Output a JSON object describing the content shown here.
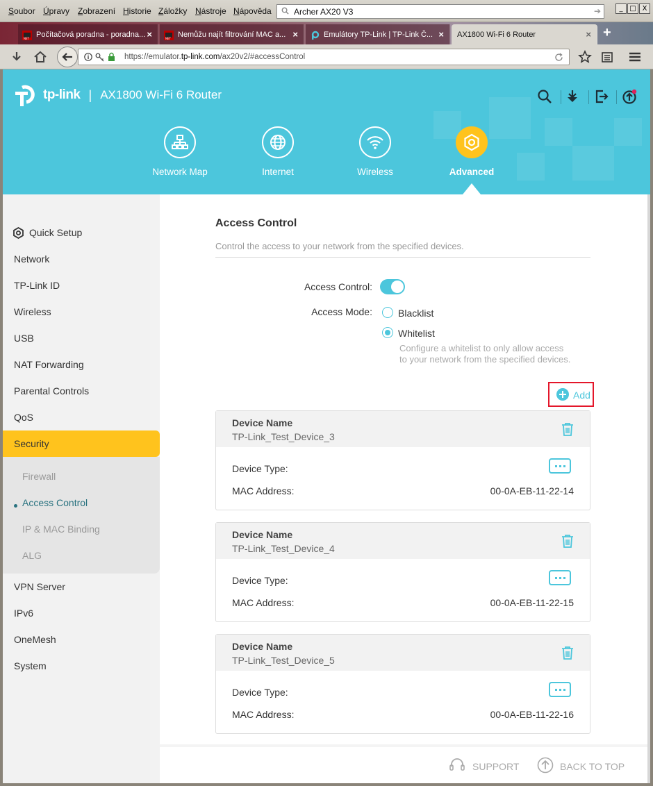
{
  "browser": {
    "menu": [
      "Soubor",
      "Úpravy",
      "Zobrazení",
      "Historie",
      "Záložky",
      "Nástroje",
      "Nápověda"
    ],
    "search_value": "Archer AX20 V3",
    "window_buttons": [
      "_",
      "□",
      "X"
    ],
    "tabs": [
      {
        "label": "Počítačová poradna - poradna...",
        "icon": "favicon-pc-poradna"
      },
      {
        "label": "Nemůžu najít filtrování MAC a...",
        "icon": "favicon-pc-poradna"
      },
      {
        "label": "Emulátory TP-Link | TP-Link Č...",
        "icon": "favicon-tplink"
      },
      {
        "label": "AX1800 Wi-Fi 6 Router",
        "icon": "none"
      }
    ],
    "url_prefix": "https://emulator.",
    "url_host": "tp-link.com",
    "url_suffix": "/ax20v2/#accessControl"
  },
  "router": {
    "logo": "tp-link",
    "separator": "|",
    "product": "AX1800 Wi-Fi 6 Router",
    "main_tabs": [
      {
        "label": "Network Map",
        "icon": "network-map-icon"
      },
      {
        "label": "Internet",
        "icon": "globe-icon"
      },
      {
        "label": "Wireless",
        "icon": "wifi-icon"
      },
      {
        "label": "Advanced",
        "icon": "gear-icon",
        "active": true
      }
    ],
    "accent_color": "#4cc6dc",
    "highlight_color": "#ffc31d"
  },
  "sidebar": {
    "items": [
      "Quick Setup",
      "Network",
      "TP-Link ID",
      "Wireless",
      "USB",
      "NAT Forwarding",
      "Parental Controls",
      "QoS",
      "Security"
    ],
    "active": "Security",
    "sub_items": [
      "Firewall",
      "Access Control",
      "IP & MAC Binding",
      "ALG"
    ],
    "active_sub": "Access Control",
    "after_items": [
      "VPN Server",
      "IPv6",
      "OneMesh",
      "System"
    ]
  },
  "content": {
    "title": "Access Control",
    "description": "Control the access to your network from the specified devices.",
    "access_control_label": "Access Control:",
    "access_control_enabled": true,
    "access_mode_label": "Access Mode:",
    "mode_blacklist": "Blacklist",
    "mode_whitelist": "Whitelist",
    "selected_mode": "Whitelist",
    "whitelist_hint_1": "Configure a whitelist to only allow access",
    "whitelist_hint_2": "to your network from the specified devices.",
    "add_label": "Add",
    "device_name_header": "Device Name",
    "device_type_label": "Device Type:",
    "mac_label": "MAC Address:",
    "devices": [
      {
        "name": "TP-Link_Test_Device_3",
        "mac": "00-0A-EB-11-22-14"
      },
      {
        "name": "TP-Link_Test_Device_4",
        "mac": "00-0A-EB-11-22-15"
      },
      {
        "name": "TP-Link_Test_Device_5",
        "mac": "00-0A-EB-11-22-16"
      }
    ]
  },
  "footer": {
    "support": "SUPPORT",
    "back_to_top": "BACK TO TOP"
  }
}
